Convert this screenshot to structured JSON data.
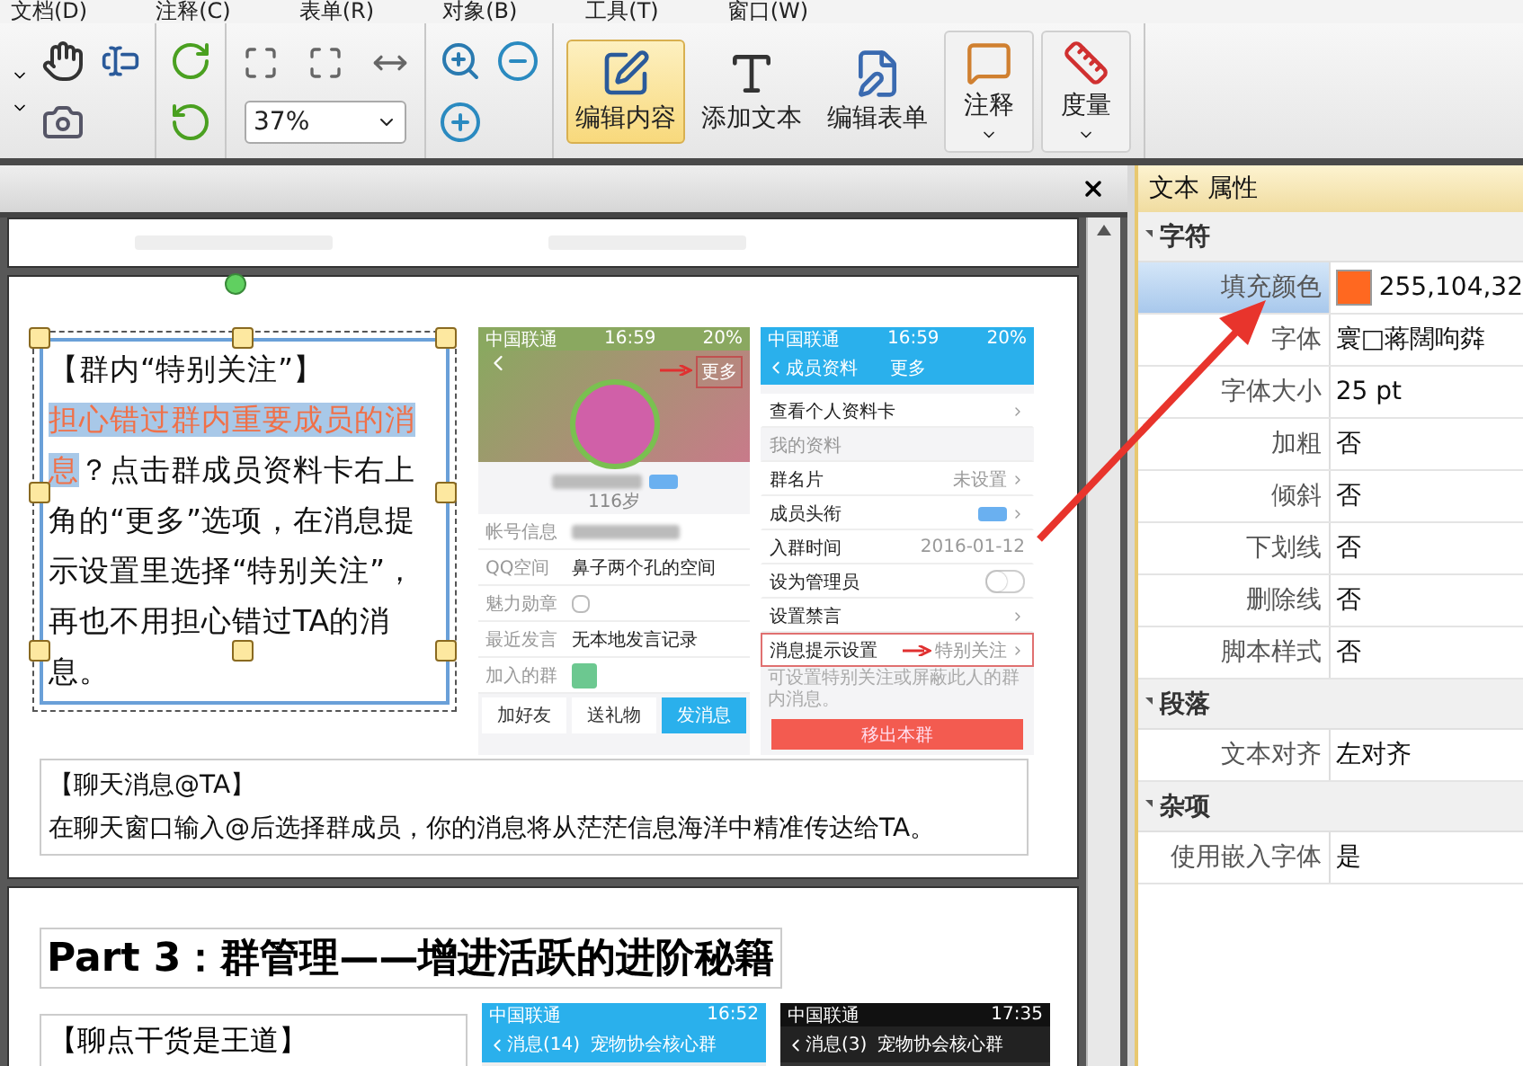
{
  "menu": [
    "文档(D)",
    "注释(C)",
    "表单(R)",
    "对象(B)",
    "工具(T)",
    "窗口(W)"
  ],
  "toolbar": {
    "zoom": "37%",
    "big_buttons": [
      {
        "label": "编辑内容",
        "selected": true,
        "dropdown": false
      },
      {
        "label": "添加文本",
        "selected": false,
        "dropdown": false
      },
      {
        "label": "编辑表单",
        "selected": false,
        "dropdown": false
      },
      {
        "label": "注释",
        "selected": false,
        "dropdown": true
      },
      {
        "label": "度量",
        "selected": false,
        "dropdown": true
      }
    ]
  },
  "document": {
    "text_box": {
      "selected": true,
      "title": "【群内“特别关注”】",
      "segments": [
        {
          "text": "担心错过群内重要成员的消息",
          "highlighted": true
        },
        {
          "text": "？点击群成员资料卡右上角的“更多”选项，在消息提示设置里选择“特别关注”，再也不用担心错过TA的消息。",
          "highlighted": false
        }
      ]
    },
    "profile_phone": {
      "carrier": "中国联通",
      "time": "16:59",
      "battery": "20%",
      "more": "更多",
      "age": "116岁",
      "rows": [
        {
          "label": "帐号信息",
          "value": "",
          "kind": "blur"
        },
        {
          "label": "QQ空间",
          "value": "鼻子两个孔的空间",
          "kind": "text"
        },
        {
          "label": "魅力勋章",
          "value": "",
          "kind": "medal"
        },
        {
          "label": "最近发言",
          "value": "无本地发言记录",
          "kind": "text"
        },
        {
          "label": "加入的群",
          "value": "",
          "kind": "group"
        }
      ],
      "buttons": [
        {
          "label": "加好友",
          "primary": false
        },
        {
          "label": "送礼物",
          "primary": false
        },
        {
          "label": "发消息",
          "primary": true
        }
      ]
    },
    "settings_phone": {
      "carrier": "中国联通",
      "time": "16:59",
      "battery": "20%",
      "back": "成员资料",
      "title": "更多",
      "rows": [
        {
          "label": "查看个人资料卡",
          "value": "",
          "kind": "link"
        },
        {
          "label": "我的资料",
          "value": "",
          "kind": "section"
        },
        {
          "label": "群名片",
          "value": "未设置",
          "kind": "link"
        },
        {
          "label": "成员头衔",
          "value": "",
          "kind": "badge"
        },
        {
          "label": "入群时间",
          "value": "2016-01-12",
          "kind": "plain"
        },
        {
          "label": "设为管理员",
          "value": "",
          "kind": "toggle",
          "on": false
        },
        {
          "label": "设置禁言",
          "value": "",
          "kind": "link"
        },
        {
          "label": "消息提示设置",
          "value": "特别关注",
          "kind": "marked"
        }
      ],
      "note": "可设置特别关注或屏蔽此人的群内消息。",
      "remove": "移出本群"
    },
    "caption": {
      "title": "【聊天消息@TA】",
      "body": "在聊天窗口输入@后选择群成员，你的消息将从茫茫信息海洋中精准传达给TA。"
    },
    "heading": "Part 3：群管理——增进活跃的进阶秘籍",
    "tip_title": "【聊点干货是王道】",
    "chat_phones": [
      {
        "back": "消息(14)",
        "title": "宠物协会核心群",
        "carrier": "中国联通",
        "time": "16:52",
        "dark": false
      },
      {
        "back": "消息(3)",
        "title": "宠物协会核心群",
        "carrier": "中国联通",
        "time": "17:35",
        "dark": true
      }
    ]
  },
  "properties": {
    "title": "文本 属性",
    "sections": [
      {
        "name": "字符",
        "expanded": true,
        "rows": [
          {
            "label": "填充颜色",
            "value": "255,104,32",
            "color": "#ff6820",
            "selected": true
          },
          {
            "label": "字体",
            "value": "寰□蒋闊呴粦",
            "selected": false
          },
          {
            "label": "字体大小",
            "value": "25 pt",
            "selected": false
          },
          {
            "label": "加粗",
            "value": "否",
            "selected": false
          },
          {
            "label": "倾斜",
            "value": "否",
            "selected": false
          },
          {
            "label": "下划线",
            "value": "否",
            "selected": false
          },
          {
            "label": "删除线",
            "value": "否",
            "selected": false
          },
          {
            "label": "脚本样式",
            "value": "否",
            "selected": false
          }
        ]
      },
      {
        "name": "段落",
        "expanded": true,
        "rows": [
          {
            "label": "文本对齐",
            "value": "左对齐",
            "selected": false
          }
        ]
      },
      {
        "name": "杂项",
        "expanded": true,
        "rows": [
          {
            "label": "使用嵌入字体",
            "value": "是",
            "selected": false
          }
        ]
      }
    ]
  }
}
